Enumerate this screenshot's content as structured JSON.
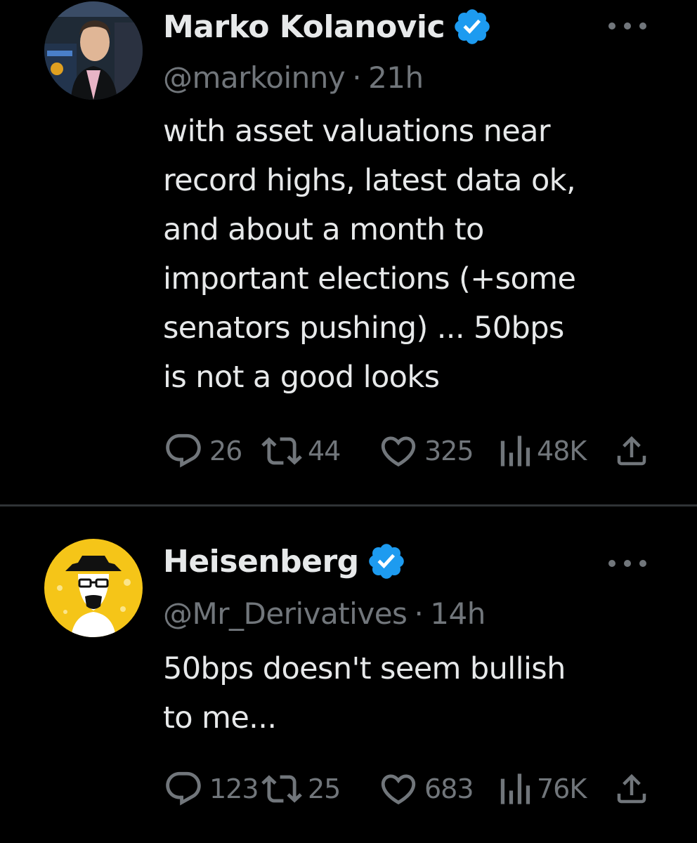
{
  "colors": {
    "background": "#000000",
    "text": "#e7e9ea",
    "secondary": "#71767b",
    "verified_badge": "#1d9bf0",
    "divider": "#2f3336"
  },
  "tweets": [
    {
      "display_name": "Marko Kolanovic",
      "handle": "@markoinny",
      "separator": "·",
      "time": "21h",
      "verified": true,
      "avatar_icon": "person-photo-avatar",
      "body": "with asset valuations near\nrecord highs, latest data ok,\nand about a month to\nimportant elections (+some\nsenators pushing) ... 50bps\nis not a good looks",
      "replies": "26",
      "retweets": "44",
      "likes": "325",
      "views": "48K"
    },
    {
      "display_name": "Heisenberg",
      "handle": "@Mr_Derivatives",
      "separator": "·",
      "time": "14h",
      "verified": true,
      "avatar_icon": "heisenberg-illustration-avatar",
      "body": "50bps doesn't seem bullish\nto me...",
      "replies": "123",
      "retweets": "25",
      "likes": "683",
      "views": "76K"
    }
  ]
}
